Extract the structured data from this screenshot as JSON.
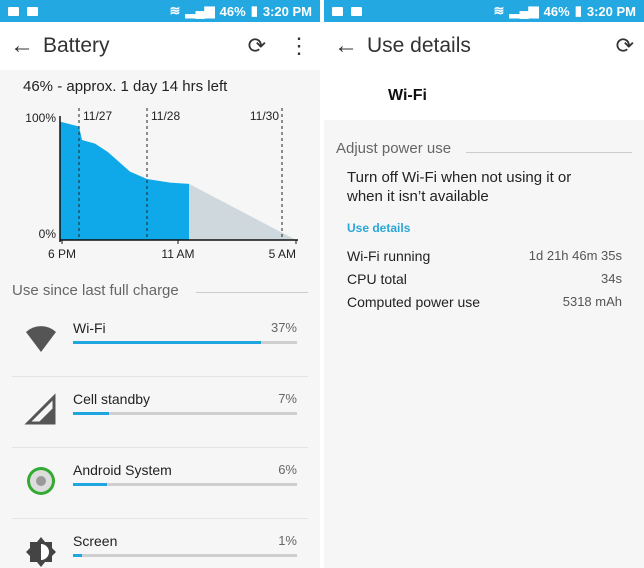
{
  "status_bar": {
    "battery": "46%",
    "time": "3:20 PM"
  },
  "battery_screen": {
    "title": "Battery",
    "summary": "46% - approx. 1 day 14 hrs left",
    "chart_data": {
      "type": "area",
      "y_ticks": [
        "100%",
        "0%"
      ],
      "x_ticks": [
        "6 PM",
        "11 AM",
        "5 AM"
      ],
      "date_markers": [
        "11/27",
        "11/28",
        "11/30"
      ],
      "ylim": [
        0,
        100
      ],
      "battery_level_percent": [
        97,
        93,
        82,
        79,
        72,
        56,
        50,
        47,
        46
      ],
      "prediction_end_percent": 0,
      "colors": {
        "actual": "#0fa8e8",
        "prediction": "#cfd8dc"
      }
    },
    "section_title": "Use since last full charge",
    "items": [
      {
        "label": "Wi-Fi",
        "percent": "37%",
        "value": 37,
        "icon": "wifi-icon",
        "bar_fraction": 0.84
      },
      {
        "label": "Cell standby",
        "percent": "7%",
        "value": 7,
        "icon": "cell-signal-icon",
        "bar_fraction": 0.16
      },
      {
        "label": "Android System",
        "percent": "6%",
        "value": 6,
        "icon": "android-system-icon",
        "bar_fraction": 0.15
      },
      {
        "label": "Screen",
        "percent": "1%",
        "value": 1,
        "icon": "brightness-icon",
        "bar_fraction": 0.04
      }
    ]
  },
  "details_screen": {
    "title": "Use details",
    "app_name": "Wi-Fi",
    "section_title": "Adjust power use",
    "tip": "Turn off Wi-Fi when not using it or when it isn’t available",
    "details_header": "Use details",
    "details": [
      {
        "label": "Wi-Fi running",
        "value": "1d 21h 46m 35s"
      },
      {
        "label": "CPU total",
        "value": "34s"
      },
      {
        "label": "Computed power use",
        "value": "5318 mAh"
      }
    ]
  },
  "accent": "#23a8e2"
}
